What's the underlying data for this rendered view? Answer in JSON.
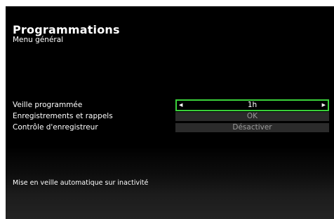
{
  "header": {
    "title": "Programmations",
    "subtitle": "Menu général"
  },
  "menu": [
    {
      "label": "Veille programmée",
      "value": "1h",
      "selected": true
    },
    {
      "label": "Enregistrements et rappels",
      "value": "OK",
      "selected": false
    },
    {
      "label": "Contrôle d'enregistreur",
      "value": "Désactiver",
      "selected": false
    }
  ],
  "hint": "Mise en veille automatique sur inactivité",
  "icons": {
    "left": "arrow-left-icon",
    "right": "arrow-right-icon"
  },
  "colors": {
    "background": "#000000",
    "selection_border": "#3ad13a",
    "value_box": "#2b2b2b"
  }
}
